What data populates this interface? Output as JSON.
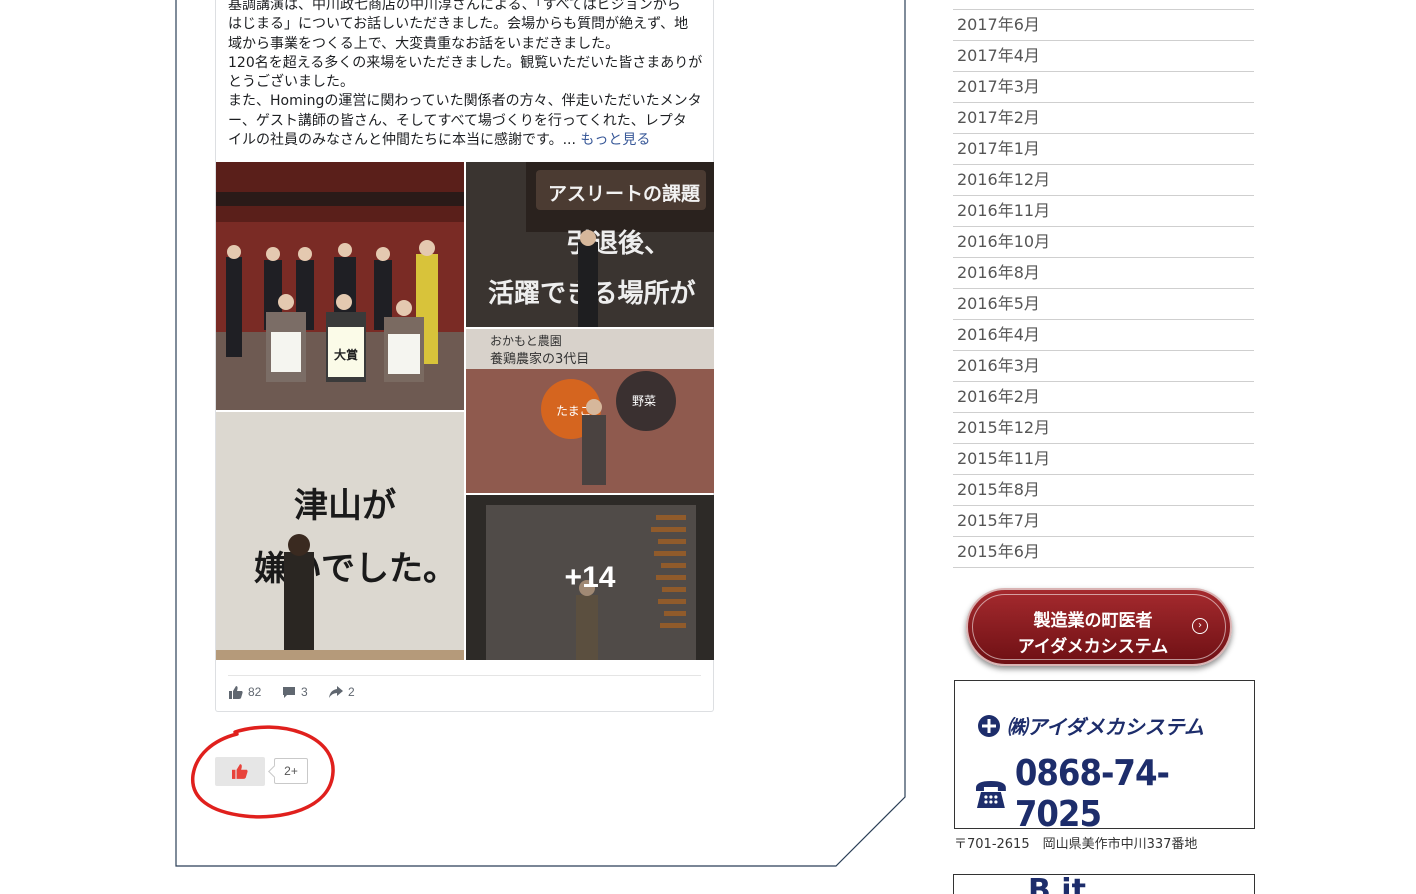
{
  "post": {
    "text": "基調講演は、中川政七商店の中川淳さんによる、「すべてはビジョンから\nはじまる」についてお話しいただきました。会場からも質問が絶えず、地\n域から事業をつくる上で、大変貴重なお話をいまだきました。\n120名を超える多くの来場をいただきました。観覧いただいた皆さまありが\nとうございました。\nまた、Homingの運営に関わっていた関係者の方々、伴走いただいたメンタ\nー、ゲスト講師の皆さん、そしてすべて場づくりを行ってくれた、レプタ\nイルの社員のみなさんと仲間たちに本当に感謝です。... ",
    "more_label": "もっと見る",
    "photo_overlay": "+14",
    "photo_texts": {
      "p2_title": "アスリートの課題",
      "p2_line1": "引退後、",
      "p2_line2": "活躍できる場所が",
      "p3_line1": "おかもと農園",
      "p3_line2": "養鶏農家の3代目",
      "p3_c1": "たまご",
      "p3_c2": "野菜",
      "p4_line1": "津山が",
      "p4_line2": "嫌いでした。",
      "p1_sign": "大賞"
    },
    "likes": "82",
    "comments": "3",
    "shares": "2"
  },
  "like_widget": {
    "count": "2+"
  },
  "archive": {
    "items": [
      "2017年6月",
      "2017年4月",
      "2017年3月",
      "2017年2月",
      "2017年1月",
      "2016年12月",
      "2016年11月",
      "2016年10月",
      "2016年8月",
      "2016年5月",
      "2016年4月",
      "2016年3月",
      "2016年2月",
      "2015年12月",
      "2015年11月",
      "2015年8月",
      "2015年7月",
      "2015年6月"
    ]
  },
  "banner": {
    "line1": "製造業の町医者",
    "line2": "アイダメカシステム",
    "accent": "#8b1a1e"
  },
  "company": {
    "name": "㈱アイダメカシステム",
    "phone": "0868-74-7025",
    "address": "〒701-2615　岡山県美作市中川337番地",
    "brand_color": "#1d2d6b"
  },
  "next_box": {
    "text": "B  it"
  },
  "annotation_color": "#e0201d"
}
